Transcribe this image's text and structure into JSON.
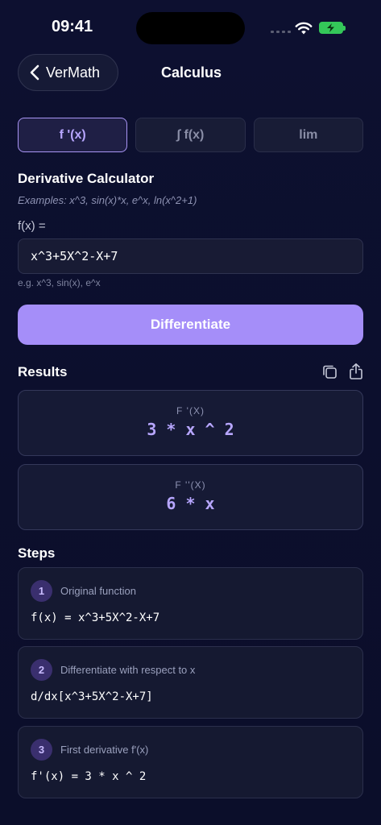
{
  "status": {
    "time": "09:41"
  },
  "nav": {
    "back_label": "VerMath",
    "title": "Calculus"
  },
  "tabs": [
    {
      "label": "f '(x)",
      "active": true
    },
    {
      "label": "∫ f(x)",
      "active": false
    },
    {
      "label": "lim",
      "active": false
    }
  ],
  "calculator": {
    "title": "Derivative Calculator",
    "examples": "Examples: x^3, sin(x)*x, e^x, ln(x^2+1)",
    "input_label": "f(x) =",
    "input_value": "x^3+5X^2-X+7",
    "hint": "e.g. x^3, sin(x), e^x",
    "button_label": "Differentiate"
  },
  "results": {
    "title": "Results",
    "items": [
      {
        "label": "F '(X)",
        "value": "3 * x ^ 2"
      },
      {
        "label": "F ''(X)",
        "value": "6 * x"
      }
    ]
  },
  "steps": {
    "title": "Steps",
    "items": [
      {
        "num": "1",
        "title": "Original function",
        "expr": "f(x) = x^3+5X^2-X+7"
      },
      {
        "num": "2",
        "title": "Differentiate with respect to x",
        "expr": "d/dx[x^3+5X^2-X+7]"
      },
      {
        "num": "3",
        "title": "First derivative f'(x)",
        "expr": "f'(x) = 3 * x ^ 2"
      }
    ]
  },
  "colors": {
    "background": "#0c0f2a",
    "accent": "#a58ef9",
    "accent_text": "#b7a6ff",
    "battery": "#34c759"
  }
}
